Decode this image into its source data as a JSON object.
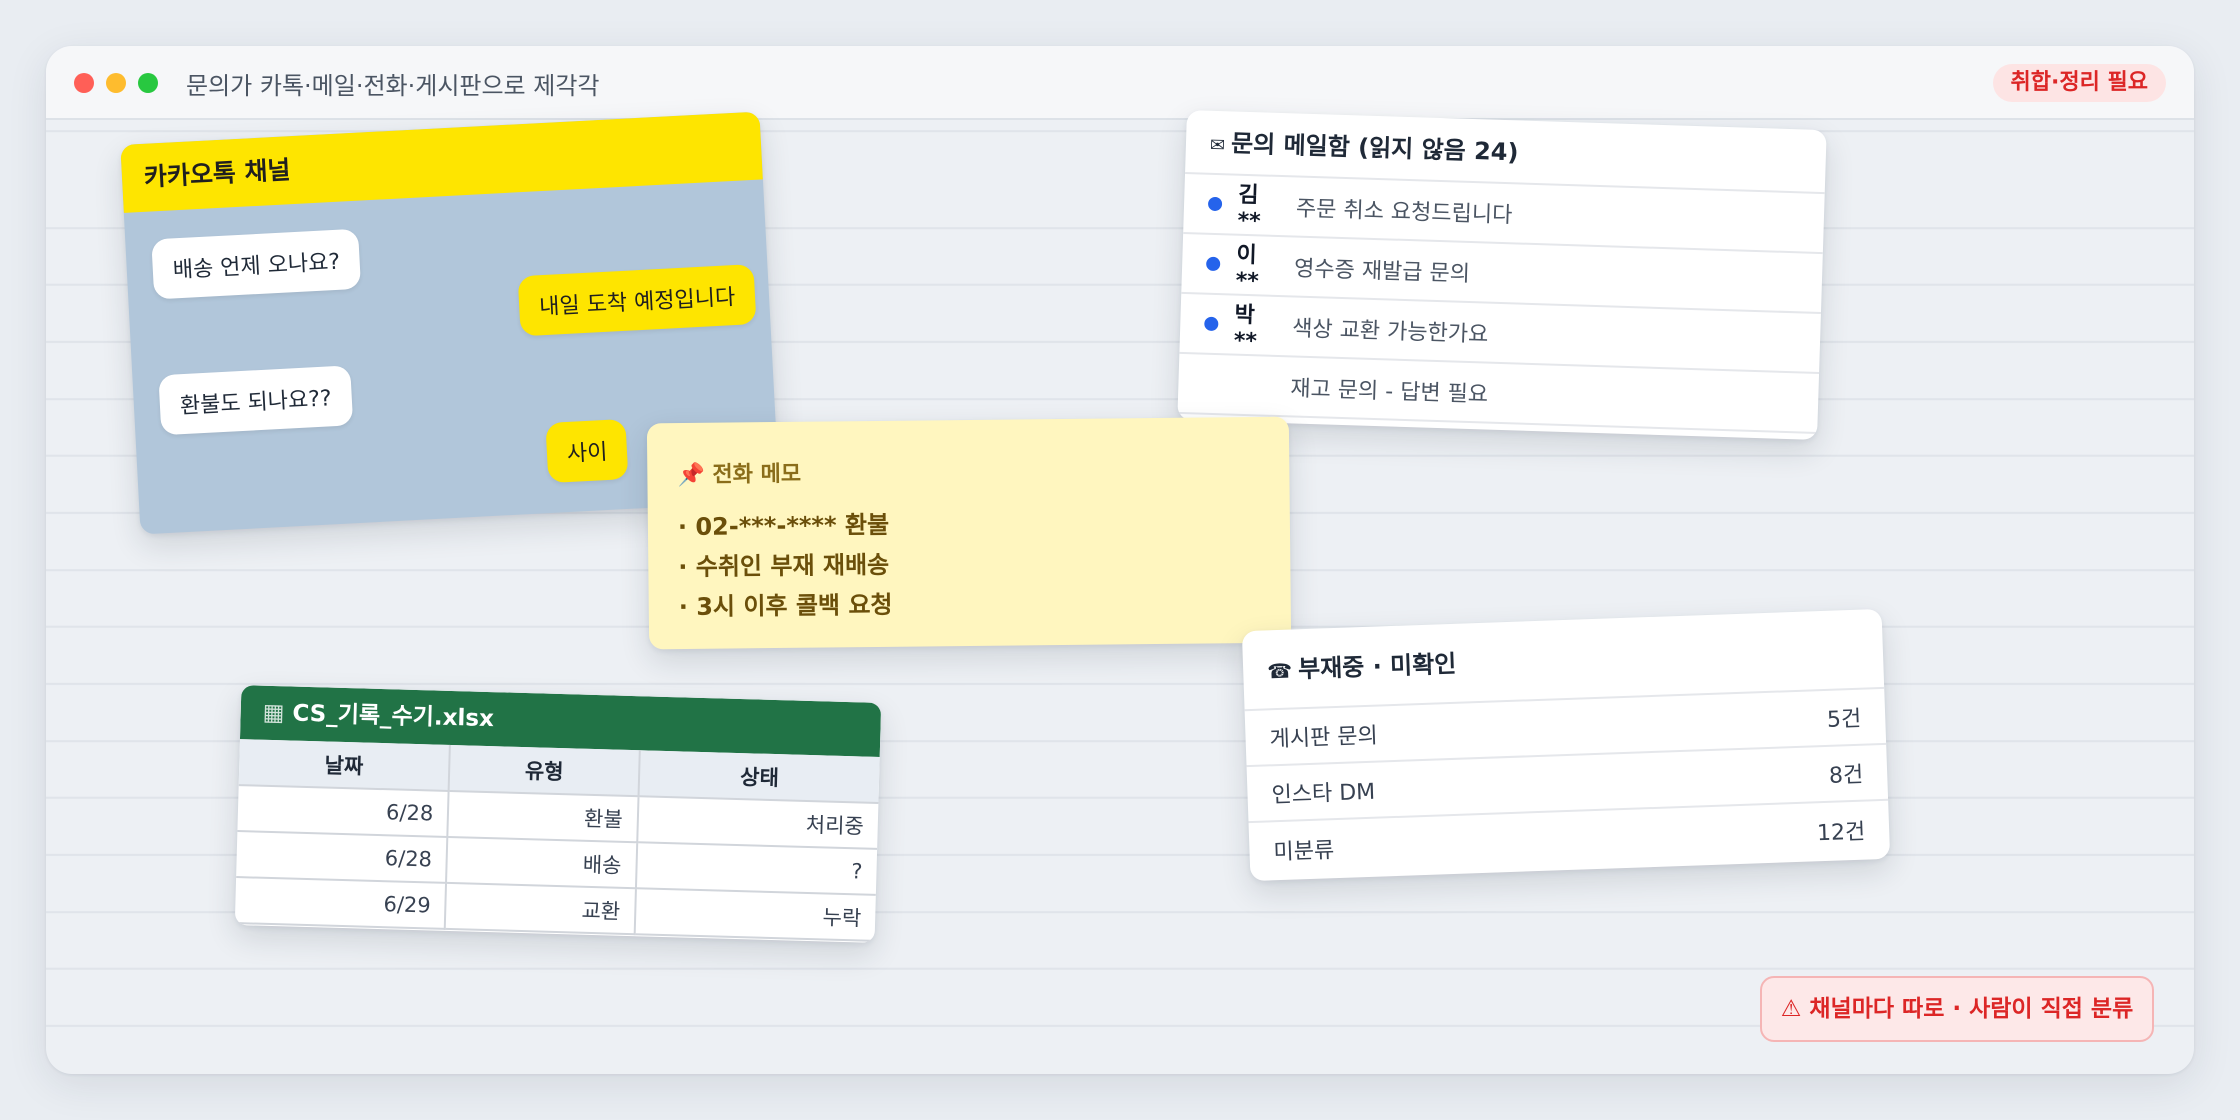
{
  "window": {
    "title": "문의가 카톡·메일·전화·게시판으로 제각각",
    "badge": "취합·정리 필요"
  },
  "kakao": {
    "title": "카카오톡 채널",
    "messages": [
      {
        "side": "in",
        "text": "배송 언제 오나요?"
      },
      {
        "side": "out",
        "text": "내일 도착 예정입니다"
      },
      {
        "side": "in",
        "text": "환불도 되나요??"
      },
      {
        "side": "out",
        "text": "사이"
      }
    ]
  },
  "mail": {
    "icon": "mail-icon",
    "title": "문의 메일함 (읽지 않음 24)",
    "rows": [
      {
        "sender": "김**",
        "subject": "주문 취소 요청드립니다",
        "unread": true
      },
      {
        "sender": "이**",
        "subject": "영수증 재발급 문의",
        "unread": true
      },
      {
        "sender": "박**",
        "subject": "색상 교환 가능한가요",
        "unread": true
      },
      {
        "sender": "",
        "subject": "재고 문의 - 답변 필요",
        "unread": false
      }
    ]
  },
  "memo": {
    "icon": "pin-icon",
    "title": "전화 메모",
    "lines": [
      "· 02-***-**** 환불",
      "· 수취인 부재 재배송",
      "· 3시 이후 콜백 요청"
    ]
  },
  "phone": {
    "icon": "phone-icon",
    "title": "부재중 · 미확인",
    "rows": [
      {
        "label": "게시판 문의",
        "count": "5건"
      },
      {
        "label": "인스타 DM",
        "count": "8건"
      },
      {
        "label": "미분류",
        "count": "12건"
      }
    ]
  },
  "sheet": {
    "icon": "spreadsheet-icon",
    "title": "CS_기록_수기.xlsx",
    "columns": [
      "날짜",
      "유형",
      "상태"
    ],
    "rows": [
      [
        "6/28",
        "환불",
        "처리중"
      ],
      [
        "6/28",
        "배송",
        "?"
      ],
      [
        "6/29",
        "교환",
        "누락"
      ]
    ]
  },
  "warning": {
    "icon": "warning-icon",
    "text": "채널마다 따로 · 사람이 직접 분류"
  },
  "colors": {
    "kakao_yellow": "#fee500",
    "kakao_bg": "#b1c6da",
    "excel_green": "#217346",
    "alert_red": "#dc2626",
    "unread_blue": "#2563eb",
    "memo_bg": "#fff6bf"
  }
}
